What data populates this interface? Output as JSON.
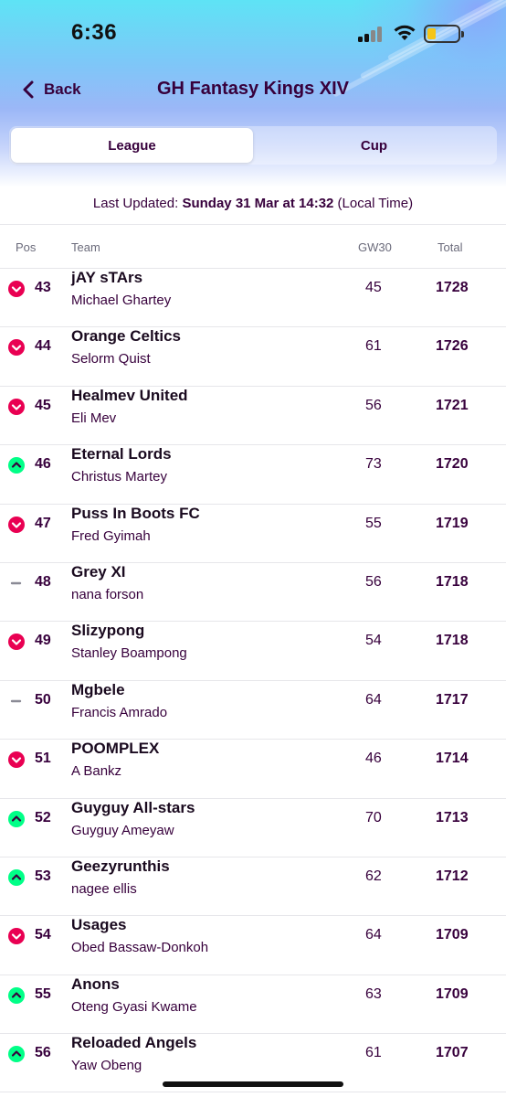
{
  "status_bar": {
    "time": "6:36"
  },
  "nav": {
    "back_label": "Back",
    "title": "GH Fantasy Kings XIV"
  },
  "tabs": [
    {
      "label": "League",
      "active": true
    },
    {
      "label": "Cup",
      "active": false
    }
  ],
  "last_updated": {
    "prefix": "Last Updated: ",
    "when": "Sunday 31 Mar at 14:32",
    "suffix": " (Local Time)"
  },
  "columns": {
    "pos": "Pos",
    "team": "Team",
    "gw": "GW30",
    "total": "Total"
  },
  "rows": [
    {
      "movement": "down",
      "pos": "43",
      "team": "jAY sTArs",
      "manager": "Michael Ghartey",
      "gw": "45",
      "total": "1728"
    },
    {
      "movement": "down",
      "pos": "44",
      "team": "Orange Celtics",
      "manager": "Selorm Quist",
      "gw": "61",
      "total": "1726"
    },
    {
      "movement": "down",
      "pos": "45",
      "team": "Healmev United",
      "manager": "Eli Mev",
      "gw": "56",
      "total": "1721"
    },
    {
      "movement": "up",
      "pos": "46",
      "team": "Eternal Lords",
      "manager": "Christus Martey",
      "gw": "73",
      "total": "1720"
    },
    {
      "movement": "down",
      "pos": "47",
      "team": "Puss In Boots FC",
      "manager": "Fred Gyimah",
      "gw": "55",
      "total": "1719"
    },
    {
      "movement": "same",
      "pos": "48",
      "team": "Grey XI",
      "manager": "nana forson",
      "gw": "56",
      "total": "1718"
    },
    {
      "movement": "down",
      "pos": "49",
      "team": "Slizypong",
      "manager": "Stanley Boampong",
      "gw": "54",
      "total": "1718"
    },
    {
      "movement": "same",
      "pos": "50",
      "team": "Mgbele",
      "manager": "Francis Amrado",
      "gw": "64",
      "total": "1717"
    },
    {
      "movement": "down",
      "pos": "51",
      "team": "POOMPLEX",
      "manager": "A Bankz",
      "gw": "46",
      "total": "1714"
    },
    {
      "movement": "up",
      "pos": "52",
      "team": "Guyguy All-stars",
      "manager": "Guyguy Ameyaw",
      "gw": "70",
      "total": "1713"
    },
    {
      "movement": "up",
      "pos": "53",
      "team": "Geezyrunthis",
      "manager": "nagee ellis",
      "gw": "62",
      "total": "1712"
    },
    {
      "movement": "down",
      "pos": "54",
      "team": "Usages",
      "manager": "Obed Bassaw-Donkoh",
      "gw": "64",
      "total": "1709"
    },
    {
      "movement": "up",
      "pos": "55",
      "team": "Anons",
      "manager": "Oteng Gyasi Kwame",
      "gw": "63",
      "total": "1709"
    },
    {
      "movement": "up",
      "pos": "56",
      "team": "Reloaded Angels",
      "manager": "Yaw Obeng",
      "gw": "61",
      "total": "1707"
    }
  ],
  "icons": {
    "back": "chevron-left-icon",
    "up": "arrow-up-icon",
    "down": "arrow-down-icon",
    "same": "dash-icon"
  },
  "colors": {
    "primary": "#37003c",
    "down": "#e90052",
    "up": "#00ff87"
  }
}
